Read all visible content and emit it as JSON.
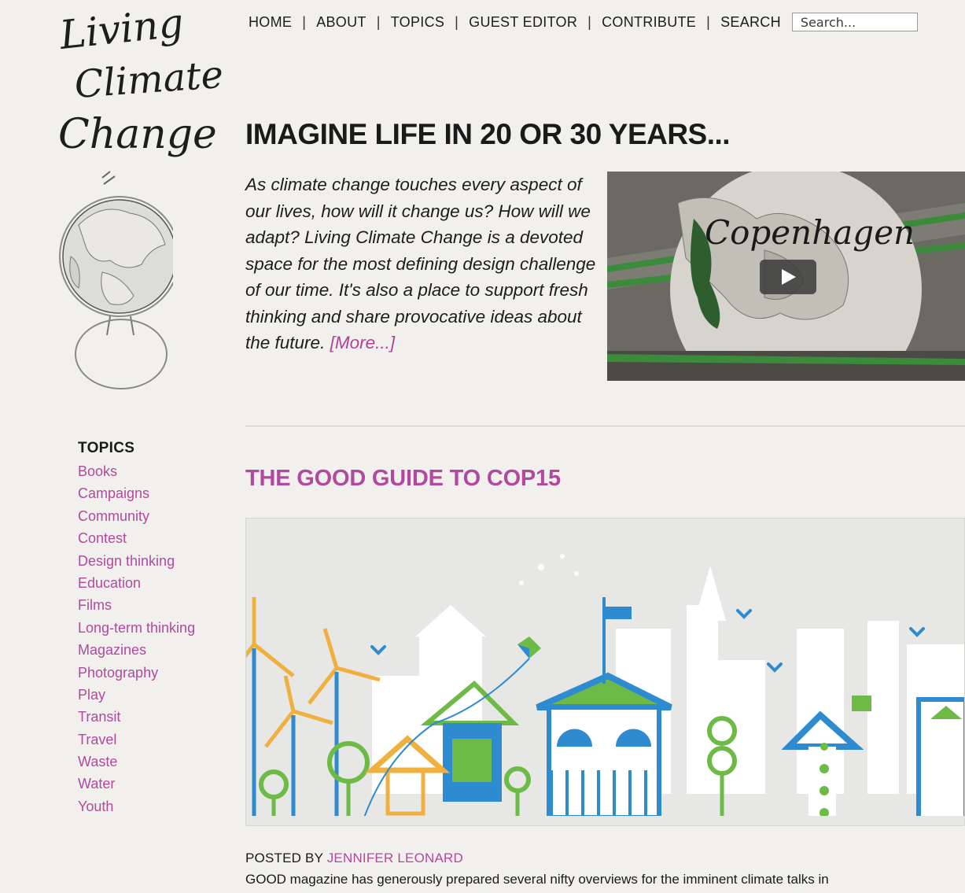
{
  "logo": {
    "lines": [
      "Living",
      "Climate",
      "Change"
    ]
  },
  "nav": {
    "items": [
      "HOME",
      "ABOUT",
      "TOPICS",
      "GUEST EDITOR",
      "CONTRIBUTE"
    ],
    "separator": "|",
    "search_label": "SEARCH",
    "search_placeholder": "Search..."
  },
  "hero": {
    "title": "IMAGINE LIFE IN 20 OR 30 YEARS...",
    "body": "As climate change touches every aspect of our lives, how will it change us? How will we adapt? Living Climate Change is a devoted space for the most defining design challenge of our time. It's also a place to support fresh thinking and share provocative ideas about the future.",
    "more_label": "[More...]",
    "video_caption": "Copenhagen"
  },
  "sidebar": {
    "heading": "TOPICS",
    "items": [
      "Books",
      "Campaigns",
      "Community",
      "Contest",
      "Design thinking",
      "Education",
      "Films",
      "Long-term thinking",
      "Magazines",
      "Photography",
      "Play",
      "Transit",
      "Travel",
      "Waste",
      "Water",
      "Youth"
    ]
  },
  "post": {
    "title": "THE GOOD GUIDE TO COP15",
    "posted_by_label": "POSTED BY",
    "author": "JENNIFER LEONARD",
    "excerpt": "GOOD magazine has generously prepared several nifty overviews for the imminent climate talks in"
  },
  "colors": {
    "accent": "#b14a9f",
    "green": "#6dba46",
    "blue": "#2f8bd0",
    "orange": "#f0b040"
  }
}
